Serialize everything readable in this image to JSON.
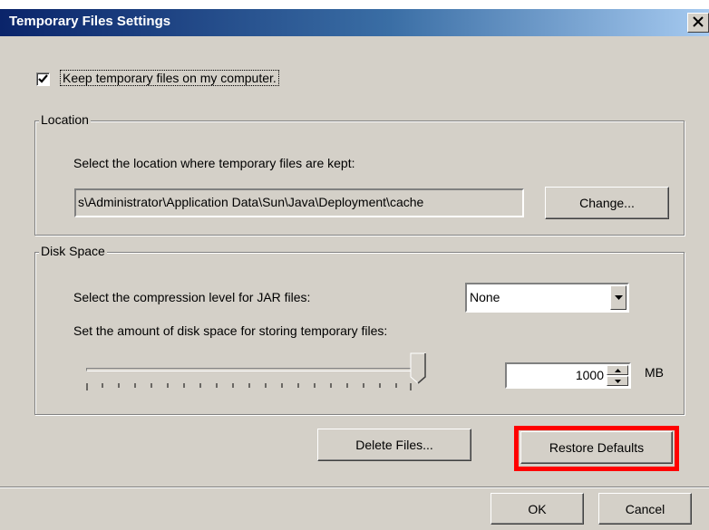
{
  "window": {
    "title": "Temporary Files Settings",
    "close_glyph": "✕"
  },
  "keep_files": {
    "label": "Keep temporary files on my computer.",
    "checked": true
  },
  "location": {
    "group_label": "Location",
    "description": "Select the location where temporary files are kept:",
    "path": "s\\Administrator\\Application Data\\Sun\\Java\\Deployment\\cache",
    "change_button": "Change..."
  },
  "disk_space": {
    "group_label": "Disk Space",
    "compression_label": "Select the compression level for JAR files:",
    "compression_value": "None",
    "amount_label": "Set the amount of disk space for storing temporary files:",
    "amount_value": "1000",
    "unit": "MB",
    "slider_level": 1.0
  },
  "buttons": {
    "delete_files": "Delete Files...",
    "restore_defaults": "Restore Defaults",
    "ok": "OK",
    "cancel": "Cancel"
  },
  "icons": {
    "close": "close-icon",
    "checkmark": "checkmark-icon",
    "dropdown": "chevron-down-icon",
    "spin_up": "spin-up-icon",
    "spin_down": "spin-down-icon"
  },
  "colors": {
    "dialog_bg": "#d4d0c8",
    "title_start": "#0a246a",
    "title_end": "#a6caf0",
    "highlight": "#ff0000"
  }
}
